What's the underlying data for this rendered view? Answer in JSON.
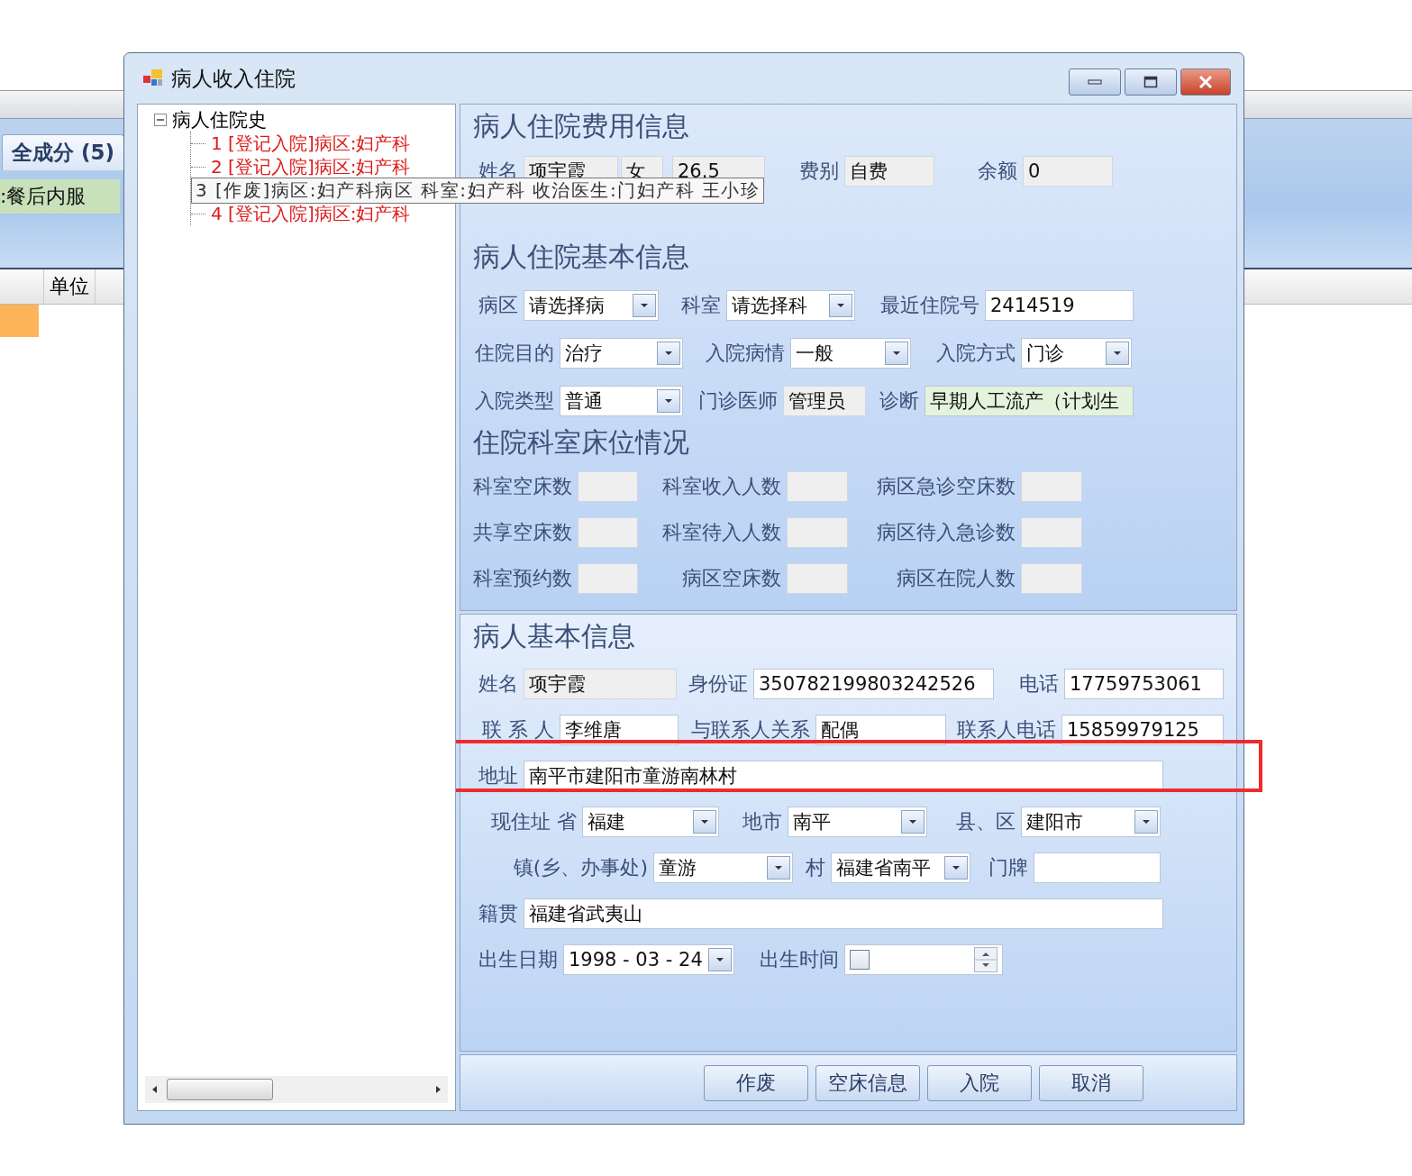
{
  "background_app": {
    "tab": "全成分 (5)",
    "usage": ":餐后内服",
    "column": "单位"
  },
  "window": {
    "title": "病人收入住院"
  },
  "tree": {
    "label": "病人住院史",
    "expanded": true,
    "children": [
      {
        "label": "1 [登记入院]病区:妇产科",
        "kind": "registered"
      },
      {
        "label": "2 [登记入院]病区:妇产科",
        "kind": "registered"
      },
      {
        "label": "3 [作废]病区:妇产科病区 科室:妇产科 收治医生:门妇产科 王小珍",
        "kind": "voided"
      },
      {
        "label": "4 [登记入院]病区:妇产科",
        "kind": "registered"
      }
    ]
  },
  "fee_section": {
    "title": "病人住院费用信息",
    "rows": [
      {
        "fields": [
          {
            "label": "姓名",
            "value": "项宇霞",
            "kind": "readonly"
          },
          {
            "value": "女",
            "kind": "readonly"
          },
          {
            "value": "26.5",
            "kind": "readonly"
          },
          {
            "label": "费别",
            "value": "自费",
            "kind": "readonly"
          },
          {
            "label": "余额",
            "value": "0",
            "kind": "readonly"
          }
        ]
      }
    ]
  },
  "admission_section": {
    "title": "病人住院基本信息",
    "rows": [
      {
        "fields": [
          {
            "label": "病区",
            "value": "请选择病",
            "kind": "combo"
          },
          {
            "label": "科室",
            "value": "请选择科",
            "kind": "combo"
          },
          {
            "label": "最近住院号",
            "value": "2414519",
            "kind": "text"
          }
        ]
      },
      {
        "fields": [
          {
            "label": "住院目的",
            "value": "治疗",
            "kind": "combo"
          },
          {
            "label": "入院病情",
            "value": "一般",
            "kind": "combo"
          },
          {
            "label": "入院方式",
            "value": "门诊",
            "kind": "combo"
          }
        ]
      },
      {
        "fields": [
          {
            "label": "入院类型",
            "value": "普通",
            "kind": "combo"
          },
          {
            "label": "门诊医师",
            "value": "管理员",
            "kind": "readonly"
          },
          {
            "label": "诊断",
            "value": "早期人工流产（计划生",
            "kind": "tinted"
          }
        ]
      }
    ]
  },
  "bed_section": {
    "title": "住院科室床位情况",
    "rows": [
      {
        "fields": [
          {
            "label": "科室空床数",
            "kind": "readonly"
          },
          {
            "label": "科室收入人数",
            "kind": "readonly"
          },
          {
            "label": "病区急诊空床数",
            "kind": "readonly"
          }
        ]
      },
      {
        "fields": [
          {
            "label": "共享空床数",
            "kind": "readonly"
          },
          {
            "label": "科室待入人数",
            "kind": "readonly"
          },
          {
            "label": "病区待入急诊数",
            "kind": "readonly"
          }
        ]
      },
      {
        "fields": [
          {
            "label": "科室预约数",
            "kind": "readonly"
          },
          {
            "label": "病区空床数",
            "kind": "readonly"
          },
          {
            "label": "病区在院人数",
            "kind": "readonly"
          }
        ]
      }
    ]
  },
  "patient_section": {
    "title": "病人基本信息",
    "rows": [
      {
        "fields": [
          {
            "label": "姓名",
            "value": "项宇霞",
            "kind": "readonly"
          },
          {
            "label": "身份证",
            "value": "350782199803242526",
            "kind": "text"
          },
          {
            "label": "电话",
            "value": "17759753061",
            "kind": "text"
          }
        ]
      },
      {
        "fields": [
          {
            "label": "联 系 人",
            "value": "李维唐",
            "kind": "text"
          },
          {
            "label": "与联系人关系",
            "value": "配偶",
            "kind": "text"
          },
          {
            "label": "联系人电话",
            "value": "15859979125",
            "kind": "text"
          }
        ]
      },
      {
        "fields": [
          {
            "label": "地址",
            "value": "南平市建阳市童游南林村",
            "kind": "text",
            "highlighted": true
          }
        ]
      },
      {
        "fields": [
          {
            "label": "现住址 省",
            "value": "福建",
            "kind": "combo"
          },
          {
            "label": "地市",
            "value": "南平",
            "kind": "combo"
          },
          {
            "label": "县、区",
            "value": "建阳市",
            "kind": "combo"
          }
        ]
      },
      {
        "fields": [
          {
            "label": "镇(乡、办事处)",
            "value": "童游",
            "kind": "combo"
          },
          {
            "label": "村",
            "value": "福建省南平",
            "kind": "combo"
          },
          {
            "label": "门牌",
            "kind": "text"
          }
        ]
      },
      {
        "fields": [
          {
            "label": "籍贯",
            "value": "福建省武夷山",
            "kind": "text"
          }
        ]
      },
      {
        "fields": [
          {
            "label": "出生日期",
            "value": "1998 - 03 - 24",
            "kind": "date"
          },
          {
            "label": "出生时间",
            "kind": "time",
            "checked": false
          }
        ]
      }
    ]
  },
  "buttons": [
    "作废",
    "空床信息",
    "入院",
    "取消"
  ]
}
